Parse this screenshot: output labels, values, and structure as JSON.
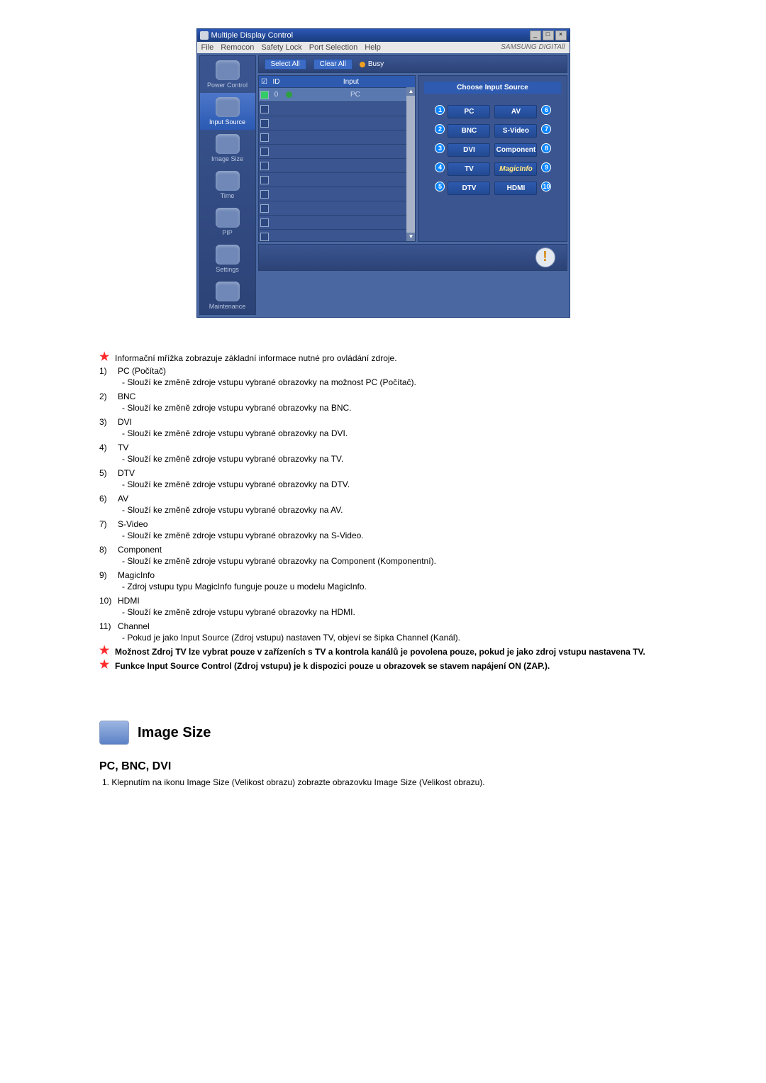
{
  "window": {
    "title": "Multiple Display Control",
    "menu": {
      "file": "File",
      "remocon": "Remocon",
      "safety": "Safety Lock",
      "port": "Port Selection",
      "help": "Help",
      "brand": "SAMSUNG DIGITAll"
    },
    "ctrl_min": "_",
    "ctrl_max": "□",
    "ctrl_close": "×"
  },
  "sidebar": {
    "items": [
      {
        "label": "Power Control"
      },
      {
        "label": "Input Source"
      },
      {
        "label": "Image Size"
      },
      {
        "label": "Time"
      },
      {
        "label": "PIP"
      },
      {
        "label": "Settings"
      },
      {
        "label": "Maintenance"
      }
    ]
  },
  "toolbar": {
    "select_all": "Select All",
    "clear_all": "Clear All",
    "busy": "Busy"
  },
  "grid": {
    "head": {
      "cb": "☑",
      "id": "ID",
      "st": "",
      "input": "Input"
    },
    "first": {
      "id": "0",
      "input": "PC"
    },
    "scroll_up": "▲",
    "scroll_down": "▼"
  },
  "right": {
    "title": "Choose Input Source",
    "sources": [
      {
        "n": "1",
        "label": "PC"
      },
      {
        "n": "6",
        "label": "AV"
      },
      {
        "n": "2",
        "label": "BNC"
      },
      {
        "n": "7",
        "label": "S-Video"
      },
      {
        "n": "3",
        "label": "DVI"
      },
      {
        "n": "8",
        "label": "Component"
      },
      {
        "n": "4",
        "label": "TV"
      },
      {
        "n": "9",
        "label": "MagicInfo"
      },
      {
        "n": "5",
        "label": "DTV"
      },
      {
        "n": "10",
        "label": "HDMI"
      }
    ]
  },
  "status": {
    "mark": "!"
  },
  "doc": {
    "intro": "Informační mřížka zobrazuje základní informace nutné pro ovládání zdroje.",
    "items": [
      {
        "n": "1)",
        "t": "PC (Počítač)",
        "s": "- Slouží ke změně zdroje vstupu vybrané obrazovky na možnost PC (Počítač)."
      },
      {
        "n": "2)",
        "t": "BNC",
        "s": "- Slouží ke změně zdroje vstupu vybrané obrazovky na BNC."
      },
      {
        "n": "3)",
        "t": "DVI",
        "s": "- Slouží ke změně zdroje vstupu vybrané obrazovky na DVI."
      },
      {
        "n": "4)",
        "t": "TV",
        "s": "- Slouží ke změně zdroje vstupu vybrané obrazovky na TV."
      },
      {
        "n": "5)",
        "t": "DTV",
        "s": "- Slouží ke změně zdroje vstupu vybrané obrazovky na DTV."
      },
      {
        "n": "6)",
        "t": "AV",
        "s": "- Slouží ke změně zdroje vstupu vybrané obrazovky na AV."
      },
      {
        "n": "7)",
        "t": "S-Video",
        "s": "- Slouží ke změně zdroje vstupu vybrané obrazovky na S-Video."
      },
      {
        "n": "8)",
        "t": "Component",
        "s": "- Slouží ke změně zdroje vstupu vybrané obrazovky na Component (Komponentní)."
      },
      {
        "n": "9)",
        "t": "MagicInfo",
        "s": "- Zdroj vstupu typu MagicInfo funguje pouze u modelu MagicInfo."
      },
      {
        "n": "10)",
        "t": "HDMI",
        "s": "- Slouží ke změně zdroje vstupu vybrané obrazovky na HDMI."
      },
      {
        "n": "11)",
        "t": "Channel",
        "s": "- Pokud je jako Input Source (Zdroj vstupu) nastaven TV, objeví se šipka Channel (Kanál)."
      }
    ],
    "note1": "Možnost Zdroj TV lze vybrat pouze v zařízeních s TV a kontrola kanálů je povolena pouze, pokud je jako zdroj vstupu nastavena TV.",
    "note2": "Funkce Input Source Control (Zdroj vstupu) je k dispozici pouze u obrazovek se stavem napájení ON (ZAP.).",
    "section_title": "Image Size",
    "sub_head": "PC, BNC, DVI",
    "sub_p": "1. Klepnutím na ikonu Image Size (Velikost obrazu) zobrazte obrazovku Image Size (Velikost obrazu)."
  }
}
